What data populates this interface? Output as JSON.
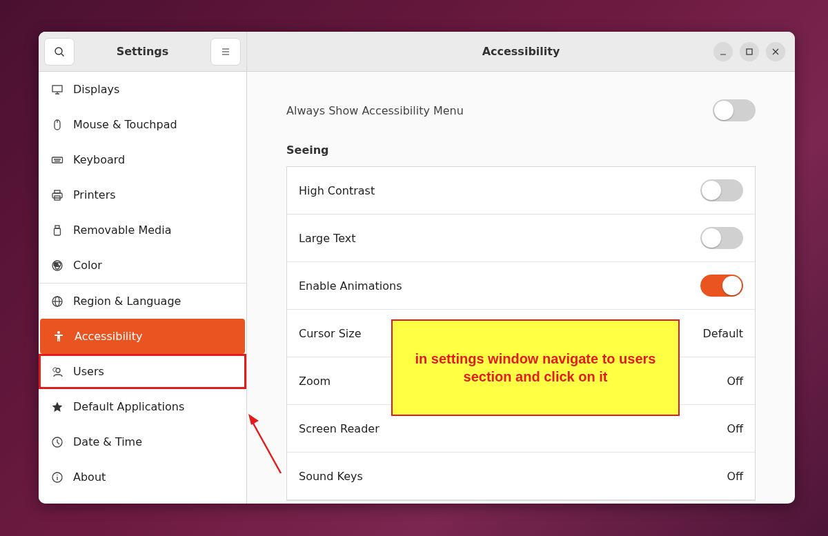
{
  "sidebar": {
    "title": "Settings",
    "items": [
      {
        "label": "Displays",
        "selected": false,
        "highlighted": false,
        "divider_after": false
      },
      {
        "label": "Mouse & Touchpad",
        "selected": false,
        "highlighted": false,
        "divider_after": false
      },
      {
        "label": "Keyboard",
        "selected": false,
        "highlighted": false,
        "divider_after": false
      },
      {
        "label": "Printers",
        "selected": false,
        "highlighted": false,
        "divider_after": false
      },
      {
        "label": "Removable Media",
        "selected": false,
        "highlighted": false,
        "divider_after": false
      },
      {
        "label": "Color",
        "selected": false,
        "highlighted": false,
        "divider_after": true
      },
      {
        "label": "Region & Language",
        "selected": false,
        "highlighted": false,
        "divider_after": false
      },
      {
        "label": "Accessibility",
        "selected": true,
        "highlighted": false,
        "divider_after": false
      },
      {
        "label": "Users",
        "selected": false,
        "highlighted": true,
        "divider_after": false
      },
      {
        "label": "Default Applications",
        "selected": false,
        "highlighted": false,
        "divider_after": false
      },
      {
        "label": "Date & Time",
        "selected": false,
        "highlighted": false,
        "divider_after": false
      },
      {
        "label": "About",
        "selected": false,
        "highlighted": false,
        "divider_after": false
      }
    ]
  },
  "window": {
    "title": "Accessibility"
  },
  "top_setting": {
    "label": "Always Show Accessibility Menu",
    "on": false
  },
  "section": {
    "title": "Seeing",
    "rows": [
      {
        "kind": "switch",
        "label": "High Contrast",
        "on": false
      },
      {
        "kind": "switch",
        "label": "Large Text",
        "on": false
      },
      {
        "kind": "switch",
        "label": "Enable Animations",
        "on": true
      },
      {
        "kind": "value",
        "label": "Cursor Size",
        "value": "Default"
      },
      {
        "kind": "value",
        "label": "Zoom",
        "value": "Off"
      },
      {
        "kind": "value",
        "label": "Screen Reader",
        "value": "Off"
      },
      {
        "kind": "value",
        "label": "Sound Keys",
        "value": "Off"
      }
    ]
  },
  "annotation": {
    "text": "in settings window navigate to users section and click on it"
  }
}
